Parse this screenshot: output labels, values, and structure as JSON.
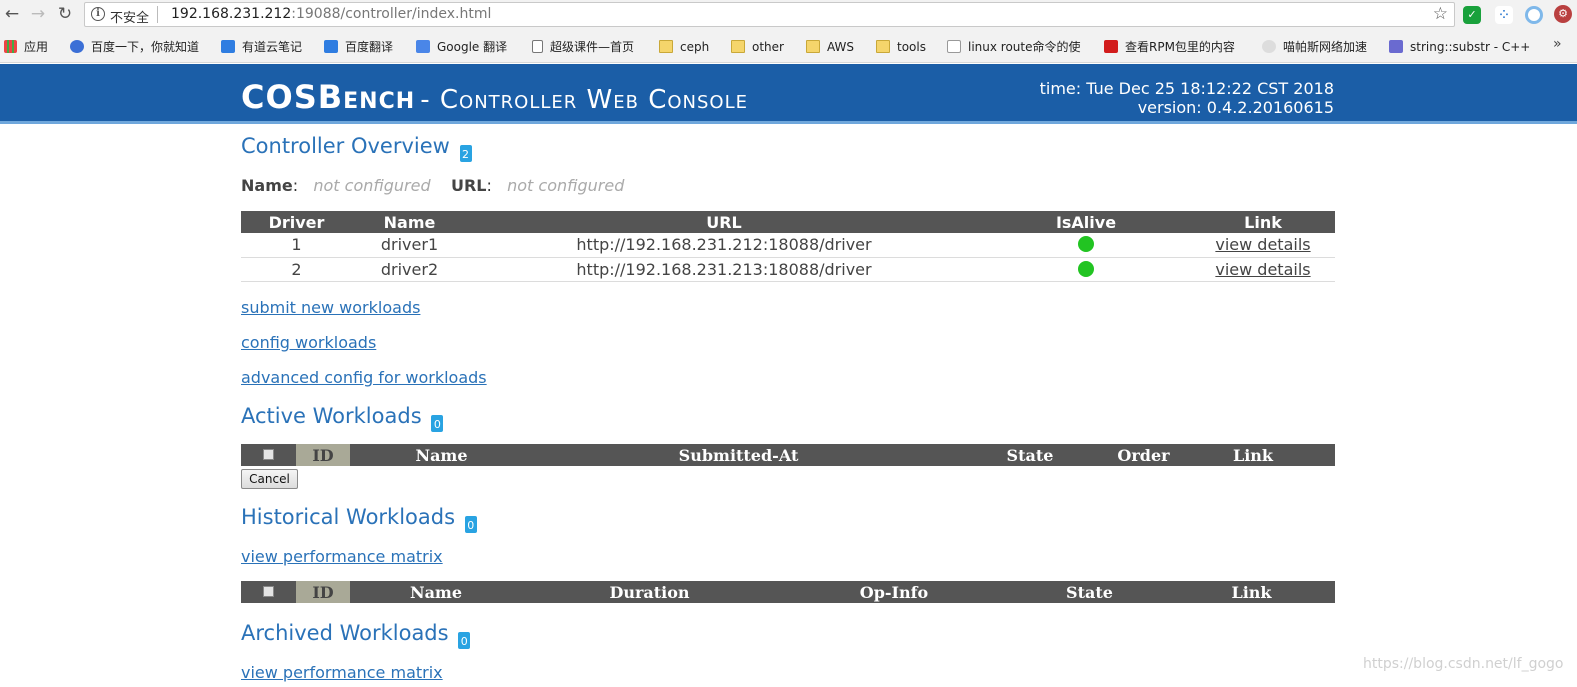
{
  "browser": {
    "security_label": "不安全",
    "url_host": "192.168.231.212",
    "url_rest": ":19088/controller/index.html",
    "bookmarks": [
      {
        "label": "应用",
        "icon": "apps-grid-icon"
      },
      {
        "label": "百度一下，你就知道",
        "icon": "baidu-paw-icon"
      },
      {
        "label": "有道云笔记",
        "icon": "youdao-note-icon"
      },
      {
        "label": "百度翻译",
        "icon": "baidu-translate-icon"
      },
      {
        "label": "Google 翻译",
        "icon": "google-translate-icon"
      },
      {
        "label": "超级课件—首页",
        "icon": "page-icon"
      },
      {
        "label": "ceph",
        "icon": "folder-icon"
      },
      {
        "label": "other",
        "icon": "folder-icon"
      },
      {
        "label": "AWS",
        "icon": "folder-icon"
      },
      {
        "label": "tools",
        "icon": "folder-icon"
      },
      {
        "label": "linux route命令的使",
        "icon": "linux-site-icon"
      },
      {
        "label": "查看RPM包里的内容",
        "icon": "csdn-icon"
      },
      {
        "label": "喵帕斯网络加速",
        "icon": "cat-icon"
      },
      {
        "label": "string::substr - C++",
        "icon": "cpp-site-icon"
      }
    ],
    "more_bookmarks": "»"
  },
  "header": {
    "brand": "COSBench",
    "subtitle": "- Controller Web Console",
    "time": "time: Tue Dec 25 18:12:22 CST 2018",
    "version": "version: 0.4.2.20160615"
  },
  "overview": {
    "title": "Controller Overview",
    "count": "2",
    "name_label": "Name",
    "name_value": "not configured",
    "url_label": "URL",
    "url_value": "not configured",
    "columns": [
      "Driver",
      "Name",
      "URL",
      "IsAlive",
      "Link"
    ],
    "drivers": [
      {
        "id": "1",
        "name": "driver1",
        "url": "http://192.168.231.212:18088/driver",
        "alive": true,
        "link": "view details"
      },
      {
        "id": "2",
        "name": "driver2",
        "url": "http://192.168.231.213:18088/driver",
        "alive": true,
        "link": "view details"
      }
    ]
  },
  "links": {
    "submit": "submit new workloads",
    "config": "config workloads",
    "advanced": "advanced config for workloads"
  },
  "active": {
    "title": "Active Workloads",
    "count": "0",
    "columns": [
      "ID",
      "Name",
      "Submitted-At",
      "State",
      "Order",
      "Link"
    ],
    "cancel_label": "Cancel"
  },
  "historical": {
    "title": "Historical Workloads",
    "count": "0",
    "matrix_link": "view performance matrix",
    "columns": [
      "ID",
      "Name",
      "Duration",
      "Op-Info",
      "State",
      "Link"
    ]
  },
  "archived": {
    "title": "Archived Workloads",
    "count": "0",
    "matrix_link": "view performance matrix"
  },
  "watermark": "https://blog.csdn.net/lf_gogo"
}
